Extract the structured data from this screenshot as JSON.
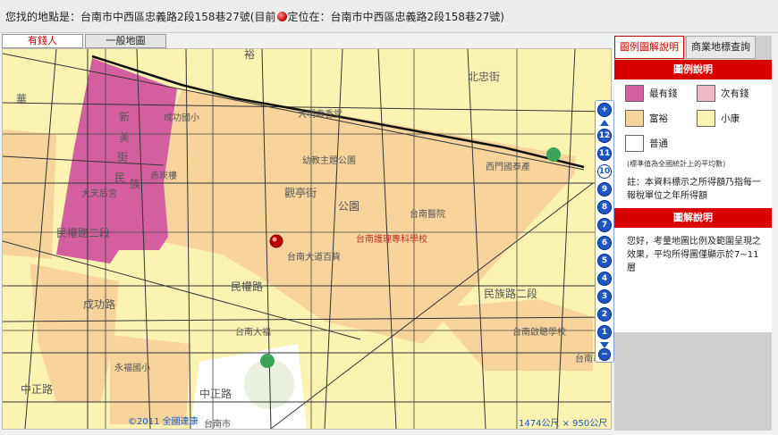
{
  "header": {
    "address_prefix": "您找的地點是：台南市中西區忠義路2段158巷27號(目前",
    "address_suffix": "定位在：台南市中西區忠義路2段158巷27號)"
  },
  "map_tabs": [
    "有錢人",
    "一般地圖"
  ],
  "sidebar": {
    "tabs": [
      "圖例圖解說明",
      "商業地標查詢"
    ],
    "legend_title": "圖例說明",
    "legend": [
      {
        "label": "最有錢",
        "color": "#d35fa0"
      },
      {
        "label": "次有錢",
        "color": "#f0b8c6"
      },
      {
        "label": "富裕",
        "color": "#f6d49c"
      },
      {
        "label": "小康",
        "color": "#fcf3b2"
      },
      {
        "label": "普通",
        "color": "#ffffff"
      }
    ],
    "note_small": "(標準值為全國統計上的平均數)",
    "note": "註：本資料標示之所得額乃指每一報稅單位之年所得額",
    "explain_title": "圖解說明",
    "explain": "您好，考量地圖比例及範圍呈現之效果，平均所得圖僅顯示於7~11層"
  },
  "zoom": {
    "levels": [
      "12",
      "11",
      "10",
      "9",
      "8",
      "7",
      "6",
      "5",
      "4",
      "3",
      "2",
      "1"
    ],
    "selected": "10",
    "zoom_in_icon": "plus-icon",
    "zoom_out_icon": "minus-icon"
  },
  "map": {
    "marker_icon": "red-location-marker-icon",
    "labels": [
      {
        "text": "新",
        "k": "s1"
      },
      {
        "text": "美",
        "k": "s2"
      },
      {
        "text": "街",
        "k": "s3"
      },
      {
        "text": "民",
        "k": "s4"
      },
      {
        "text": "族",
        "k": "s5"
      },
      {
        "text": "大天后宮",
        "k": "s6"
      },
      {
        "text": "成功國小",
        "k": "s7"
      },
      {
        "text": "赤崁樓",
        "k": "s8"
      },
      {
        "text": "幼教主題公園",
        "k": "s9"
      },
      {
        "text": "台南醫院",
        "k": "s10"
      },
      {
        "text": "台南護理專科學校",
        "k": "s11"
      },
      {
        "text": "台南大道百貨",
        "k": "s12"
      },
      {
        "text": "台南大福",
        "k": "s13"
      },
      {
        "text": "永福國小",
        "k": "s14"
      },
      {
        "text": "民族路二段",
        "k": "s15"
      },
      {
        "text": "民權路二段",
        "k": "s16"
      },
      {
        "text": "民權路",
        "k": "s17"
      },
      {
        "text": "中正路",
        "k": "s18"
      },
      {
        "text": "成功路",
        "k": "s19"
      },
      {
        "text": "西門國泰產",
        "k": "s20"
      },
      {
        "text": "公園",
        "k": "s21"
      },
      {
        "text": "觀亭街",
        "k": "s22"
      },
      {
        "text": "北忠街",
        "k": "s23"
      },
      {
        "text": "台南啟聰學校",
        "k": "s24"
      },
      {
        "text": "華",
        "k": "s25"
      },
      {
        "text": "裕",
        "k": "s26"
      },
      {
        "text": "大明壽香堂",
        "k": "s27"
      },
      {
        "text": "台南市",
        "k": "s28"
      },
      {
        "text": "中正路",
        "k": "s29"
      },
      {
        "text": "台南市",
        "k": "s30"
      }
    ]
  },
  "footer": {
    "copyright": "©2011 全國達康",
    "scale": "1474公尺 × 950公尺"
  }
}
